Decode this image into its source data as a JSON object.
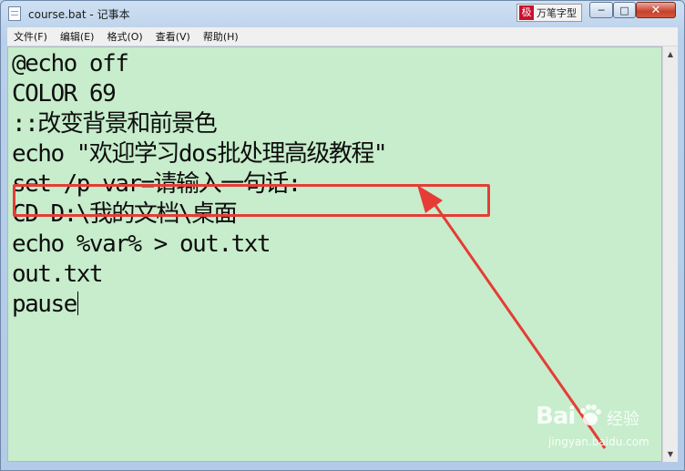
{
  "window": {
    "title": "course.bat - 记事本"
  },
  "ime": {
    "logo": "极",
    "label": "万笔字型"
  },
  "controls": {
    "minimize": "▭",
    "maximize": "□",
    "close": "✕"
  },
  "menu": {
    "items": [
      "文件(F)",
      "编辑(E)",
      "格式(O)",
      "查看(V)",
      "帮助(H)"
    ]
  },
  "editor": {
    "background": "#c7edcc",
    "lines": [
      "@echo off",
      "COLOR 69",
      "::改变背景和前景色",
      "echo \"欢迎学习dos批处理高级教程\"",
      "set /p var=请输入一句话:",
      "CD D:\\我的文档\\桌面",
      "echo %var% > out.txt",
      "out.txt",
      "pause"
    ]
  },
  "annotation": {
    "color": "#e53d36"
  },
  "watermark": {
    "brand": "Bai",
    "cn": "经验",
    "url": "jingyan.baidu.com"
  }
}
